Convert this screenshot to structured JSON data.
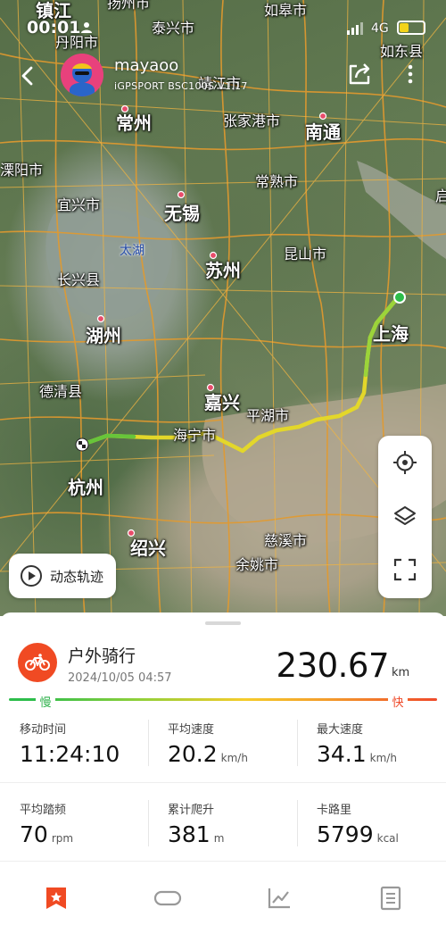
{
  "status_bar": {
    "time": "00:01",
    "network": "4G",
    "battery_level": 0.35
  },
  "header": {
    "username": "mayaoo",
    "device": "iGPSPORT BSC100S V1.17"
  },
  "map": {
    "labels": [
      {
        "text": "镇江",
        "size": "big"
      },
      {
        "text": "扬州市",
        "size": "mid"
      },
      {
        "text": "如皋市",
        "size": "mid"
      },
      {
        "text": "丹阳市",
        "size": "mid"
      },
      {
        "text": "泰兴市",
        "size": "mid"
      },
      {
        "text": "如东县",
        "size": "mid"
      },
      {
        "text": "靖江市",
        "size": "mid"
      },
      {
        "text": "常州",
        "size": "big"
      },
      {
        "text": "张家港市",
        "size": "mid"
      },
      {
        "text": "南通",
        "size": "big"
      },
      {
        "text": "溧阳市",
        "size": "mid"
      },
      {
        "text": "常熟市",
        "size": "mid"
      },
      {
        "text": "宜兴市",
        "size": "mid"
      },
      {
        "text": "无锡",
        "size": "big"
      },
      {
        "text": "启",
        "size": "mid"
      },
      {
        "text": "太湖",
        "size": "water"
      },
      {
        "text": "苏州",
        "size": "big"
      },
      {
        "text": "昆山市",
        "size": "mid"
      },
      {
        "text": "长兴县",
        "size": "mid"
      },
      {
        "text": "上海",
        "size": "big"
      },
      {
        "text": "湖州",
        "size": "big"
      },
      {
        "text": "德清县",
        "size": "mid"
      },
      {
        "text": "嘉兴",
        "size": "big"
      },
      {
        "text": "平湖市",
        "size": "mid"
      },
      {
        "text": "海宁市",
        "size": "mid"
      },
      {
        "text": "杭州",
        "size": "big"
      },
      {
        "text": "绍兴",
        "size": "big"
      },
      {
        "text": "慈溪市",
        "size": "mid"
      },
      {
        "text": "余姚市",
        "size": "mid"
      }
    ],
    "playback_label": "动态轨迹"
  },
  "activity": {
    "title": "户外骑行",
    "datetime": "2024/10/05 04:57",
    "distance": "230.67",
    "distance_unit": "km",
    "speed_legend": {
      "slow": "慢",
      "fast": "快"
    }
  },
  "stats": [
    {
      "label": "移动时间",
      "value": "11:24:10",
      "unit": ""
    },
    {
      "label": "平均速度",
      "value": "20.2",
      "unit": "km/h"
    },
    {
      "label": "最大速度",
      "value": "34.1",
      "unit": "km/h"
    },
    {
      "label": "平均踏频",
      "value": "70",
      "unit": "rpm"
    },
    {
      "label": "累计爬升",
      "value": "381",
      "unit": "m"
    },
    {
      "label": "卡路里",
      "value": "5799",
      "unit": "kcal"
    }
  ],
  "colors": {
    "accent": "#f04a23",
    "route_start": "#2dbd4b",
    "route_mid": "#c8dc2a",
    "route_fast": "#f5cc2a"
  },
  "icons": {
    "back": "chevron-left-icon",
    "share": "share-icon",
    "more": "more-vertical-icon",
    "locate": "locate-icon",
    "layers": "layers-icon",
    "fullscreen": "fullscreen-icon",
    "play": "play-circle-icon",
    "bike": "bicycle-icon",
    "nav": [
      "bookmark-star-icon",
      "route-icon",
      "chart-icon",
      "document-icon"
    ]
  }
}
